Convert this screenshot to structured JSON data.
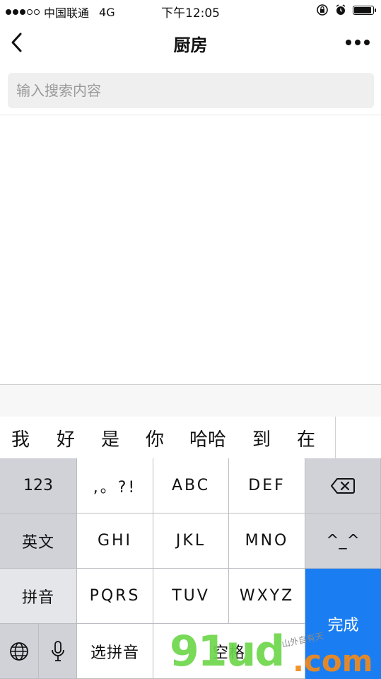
{
  "status_bar": {
    "carrier": "中国联通",
    "network": "4G",
    "time": "下午12:05"
  },
  "nav": {
    "title": "厨房"
  },
  "search": {
    "placeholder": "输入搜索内容",
    "value": ""
  },
  "candidates": [
    "我",
    "好",
    "是",
    "你",
    "哈哈",
    "到",
    "在"
  ],
  "keyboard": {
    "numbers": "123",
    "punct": ",。?!",
    "abc": "ABC",
    "def": "DEF",
    "english": "英文",
    "ghi": "GHI",
    "jkl": "JKL",
    "mno": "MNO",
    "emoticon": "^_^",
    "pinyin": "拼音",
    "pqrs": "PQRS",
    "tuv": "TUV",
    "wxyz": "WXYZ",
    "select_pinyin": "选拼音",
    "space": "空格",
    "done": "完成"
  },
  "watermark": {
    "logo": "91ud",
    "domain": ".com",
    "tagline": "山外自有天"
  },
  "colors": {
    "done_key": "#1a7ef2",
    "function_key": "#d1d2d8",
    "watermark_green": "#6ed64a",
    "watermark_orange": "#f28a1a"
  },
  "icons": {
    "back": "chevron-left-icon",
    "more": "more-dots-icon",
    "backspace": "backspace-icon",
    "globe": "globe-icon",
    "mic": "microphone-icon",
    "collapse": "chevron-up-icon"
  }
}
